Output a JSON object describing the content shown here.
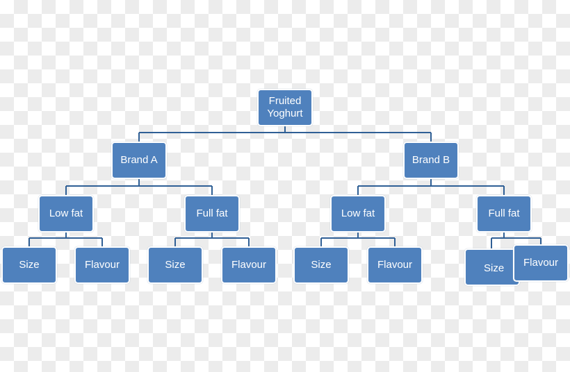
{
  "colors": {
    "node": "#4f81bd",
    "connector": "#2f5f95"
  },
  "root": {
    "label": "Fruited Yoghurt",
    "children": [
      {
        "label": "Brand A",
        "children": [
          {
            "label": "Low fat",
            "children": [
              {
                "label": "Size"
              },
              {
                "label": "Flavour"
              }
            ]
          },
          {
            "label": "Full fat",
            "children": [
              {
                "label": "Size"
              },
              {
                "label": "Flavour"
              }
            ]
          }
        ]
      },
      {
        "label": "Brand B",
        "children": [
          {
            "label": "Low fat",
            "children": [
              {
                "label": "Size"
              },
              {
                "label": "Flavour"
              }
            ]
          },
          {
            "label": "Full fat",
            "children": [
              {
                "label": "Size"
              },
              {
                "label": "Flavour"
              }
            ]
          }
        ]
      }
    ]
  }
}
